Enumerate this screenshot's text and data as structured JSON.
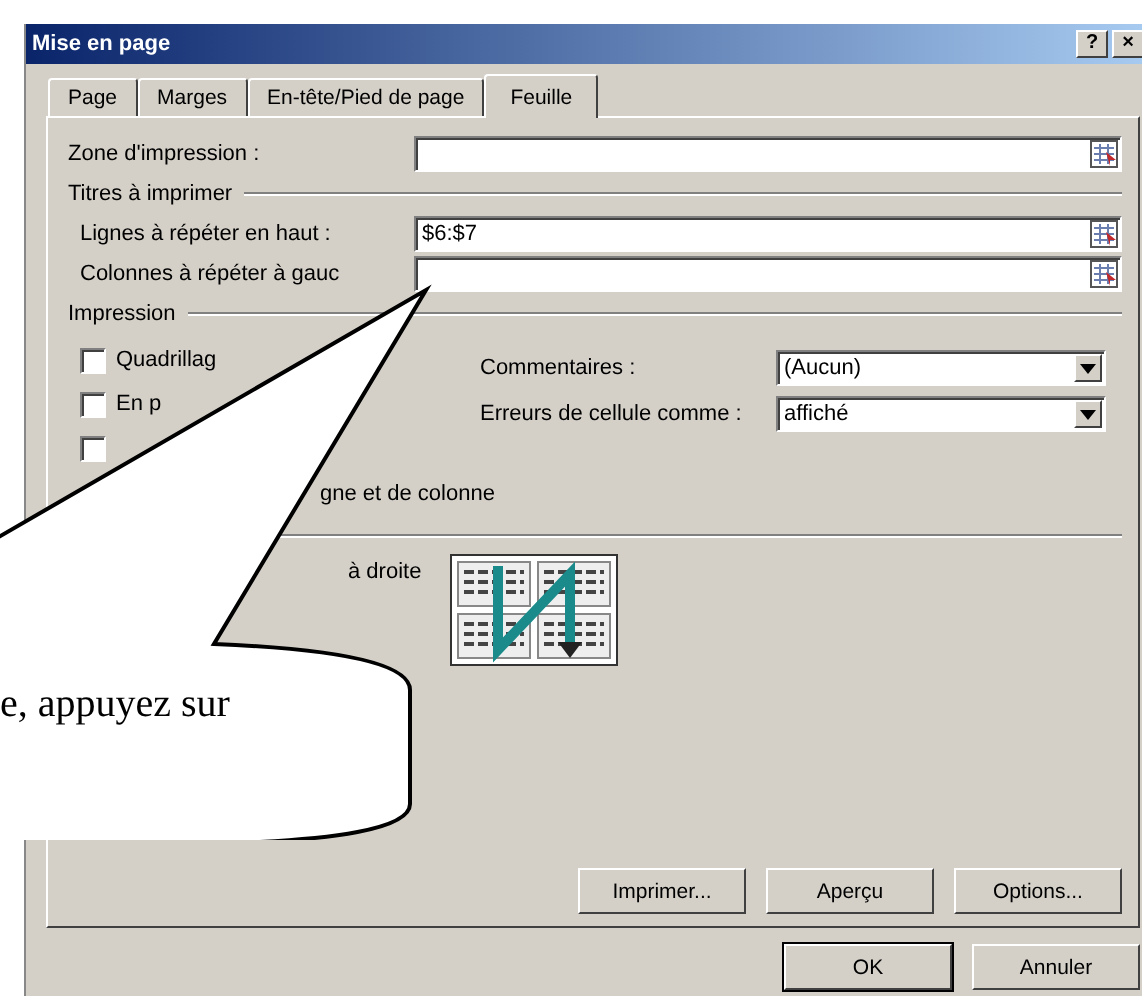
{
  "window": {
    "title": "Mise en page",
    "help_button": "?",
    "close_button": "×"
  },
  "tabs": [
    {
      "label": "Page",
      "selected": false
    },
    {
      "label": "Marges",
      "selected": false
    },
    {
      "label": "En-tête/Pied de page",
      "selected": false
    },
    {
      "label": "Feuille",
      "selected": true
    }
  ],
  "print_area": {
    "label": "Zone d'impression :"
  },
  "print_titles": {
    "heading": "Titres à imprimer",
    "fields": [
      {
        "label": "Lignes à répéter en haut :",
        "value": "$6:$7"
      },
      {
        "label": "Colonnes à répéter à gauc"
      }
    ]
  },
  "printing": {
    "heading": "Impression",
    "checkboxes": [
      {
        "label": "Quadrillag",
        "checked": false
      },
      {
        "label": "En p",
        "checked": false
      },
      {
        "checked": false
      }
    ],
    "row_label": "gne et de colonne",
    "dropdowns": [
      {
        "label": "Commentaires :",
        "value": "(Aucun)"
      },
      {
        "label": "Erreurs de cellule comme :",
        "value": "affiché"
      }
    ]
  },
  "page_order": {
    "option": "à droite"
  },
  "panel_buttons": [
    "Imprimer...",
    "Aperçu",
    "Options..."
  ],
  "dialog_buttons": [
    "OK",
    "Annuler"
  ],
  "callout": {
    "text": "e, appuyez sur"
  }
}
